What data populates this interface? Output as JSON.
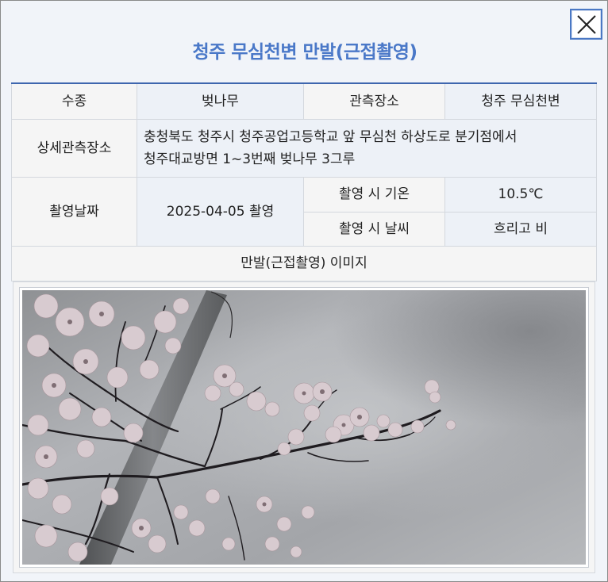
{
  "popup": {
    "title": "청주 무심천변 만발(근접촬영)",
    "close_icon": "close-icon"
  },
  "info": {
    "species_label": "수종",
    "species_value": "벚나무",
    "location_label": "관측장소",
    "location_value": "청주 무심천변",
    "detail_label": "상세관측장소",
    "detail_value_line1": "충청북도 청주시 청주공업고등학교 앞 무심천 하상도로 분기점에서",
    "detail_value_line2": "청주대교방면 1~3번째 벚나무 3그루",
    "date_label": "촬영날짜",
    "date_value": "2025-04-05 촬영",
    "temp_label": "촬영 시 기온",
    "temp_value": "10.5℃",
    "weather_label": "촬영 시 날씨",
    "weather_value": "흐리고 비",
    "image_section_label": "만발(근접촬영) 이미지"
  },
  "colors": {
    "title": "#4a78c8",
    "table_top_border": "#3e66ae",
    "sky": "#a9abae",
    "pole": "#6f7173",
    "blossom": "#d9ccd0",
    "branch": "#1d1b1e"
  }
}
